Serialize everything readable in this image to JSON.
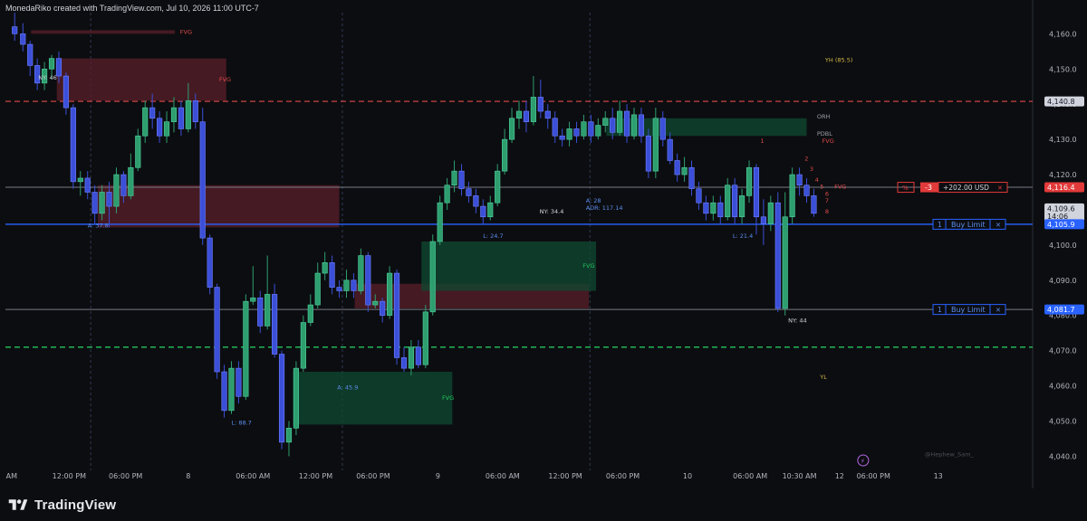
{
  "header": {
    "attribution": "MonedaRiko created with TradingView.com, Jul 10, 2026 11:00 UTC-7"
  },
  "footer": {
    "brand": "TradingView"
  },
  "colors": {
    "background": "#0c0d10",
    "bull": "#2e9e6f",
    "bear": "#3b4fd8",
    "fvg_bear": "#5a1f2a",
    "fvg_bull": "#0f4a32",
    "red_level": "#e04a4a",
    "green_level": "#22c55e",
    "blue_level": "#2962ff",
    "current_price_bg": "#e23a3a"
  },
  "chart_data": {
    "type": "candlestick",
    "title": "",
    "price_axis": {
      "ylim": [
        4036,
        4166
      ],
      "ticks": [
        "4,160.0",
        "4,150.0",
        "4,140.0",
        "4,130.0",
        "4,120.0",
        "4,110.0",
        "4,100.0",
        "4,090.0",
        "4,080.0",
        "4,070.0",
        "4,060.0",
        "4,050.0",
        "4,040.0"
      ],
      "tick_values": [
        4160,
        4150,
        4140,
        4130,
        4120,
        4110,
        4100,
        4090,
        4080,
        4070,
        4060,
        4050,
        4040
      ],
      "position": "right"
    },
    "time_axis": {
      "xlim": [
        0,
        100
      ],
      "labels": [
        {
          "t": 0.6,
          "text": "AM"
        },
        {
          "t": 6.2,
          "text": "12:00 PM"
        },
        {
          "t": 11.7,
          "text": "06:00 PM"
        },
        {
          "t": 17.8,
          "text": "8"
        },
        {
          "t": 24.1,
          "text": "06:00 AM"
        },
        {
          "t": 30.2,
          "text": "12:00 PM"
        },
        {
          "t": 35.8,
          "text": "06:00 PM"
        },
        {
          "t": 42.1,
          "text": "9"
        },
        {
          "t": 48.4,
          "text": "06:00 AM"
        },
        {
          "t": 54.5,
          "text": "12:00 PM"
        },
        {
          "t": 60.1,
          "text": "06:00 PM"
        },
        {
          "t": 66.4,
          "text": "10"
        },
        {
          "t": 72.5,
          "text": "06:00 AM"
        },
        {
          "t": 77.3,
          "text": "10:30 AM"
        },
        {
          "t": 81.2,
          "text": "12"
        },
        {
          "t": 84.5,
          "text": "06:00 PM"
        },
        {
          "t": 90.8,
          "text": "13"
        }
      ],
      "session_dividers": [
        8.3,
        32.8,
        56.9
      ]
    },
    "candles": [
      [
        0.9,
        4162,
        4160,
        4166,
        4158
      ],
      [
        1.7,
        4160,
        4157,
        4163,
        4155
      ],
      [
        2.4,
        4157,
        4151,
        4158,
        4148
      ],
      [
        3.1,
        4151,
        4146,
        4153,
        4144
      ],
      [
        3.8,
        4146,
        4150,
        4152,
        4144
      ],
      [
        4.5,
        4150,
        4153,
        4154,
        4147
      ],
      [
        5.2,
        4153,
        4148,
        4155,
        4146
      ],
      [
        5.9,
        4148,
        4139,
        4149,
        4137
      ],
      [
        6.6,
        4139,
        4118,
        4140,
        4116
      ],
      [
        7.3,
        4118,
        4119,
        4121,
        4114
      ],
      [
        8.0,
        4119,
        4115,
        4121,
        4113
      ],
      [
        8.7,
        4115,
        4109,
        4117,
        4106
      ],
      [
        9.4,
        4109,
        4115,
        4117,
        4107
      ],
      [
        10.1,
        4115,
        4111,
        4118,
        4105
      ],
      [
        10.8,
        4111,
        4120,
        4122,
        4109
      ],
      [
        11.5,
        4120,
        4114,
        4121,
        4112
      ],
      [
        12.2,
        4114,
        4122,
        4126,
        4113
      ],
      [
        12.9,
        4122,
        4131,
        4133,
        4121
      ],
      [
        13.6,
        4131,
        4139,
        4141,
        4129
      ],
      [
        14.3,
        4139,
        4136,
        4143,
        4133
      ],
      [
        15.0,
        4136,
        4131,
        4138,
        4129
      ],
      [
        15.7,
        4131,
        4135,
        4138,
        4129
      ],
      [
        16.4,
        4135,
        4139,
        4142,
        4132
      ],
      [
        17.1,
        4139,
        4133,
        4141,
        4131
      ],
      [
        17.8,
        4133,
        4141,
        4146,
        4132
      ],
      [
        18.5,
        4141,
        4135,
        4143,
        4133
      ],
      [
        19.2,
        4135,
        4102,
        4139,
        4100
      ],
      [
        19.9,
        4102,
        4088,
        4103,
        4086
      ],
      [
        20.6,
        4088,
        4064,
        4089,
        4062
      ],
      [
        21.3,
        4064,
        4053,
        4066,
        4051
      ],
      [
        22.0,
        4053,
        4065,
        4067,
        4052
      ],
      [
        22.7,
        4065,
        4057,
        4067,
        4055
      ],
      [
        23.4,
        4057,
        4084,
        4086,
        4056
      ],
      [
        24.1,
        4084,
        4085,
        4094,
        4083
      ],
      [
        24.8,
        4085,
        4077,
        4087,
        4075
      ],
      [
        25.5,
        4077,
        4086,
        4097,
        4076
      ],
      [
        26.2,
        4086,
        4069,
        4089,
        4068
      ],
      [
        26.9,
        4069,
        4044,
        4070,
        4042
      ],
      [
        27.6,
        4044,
        4048,
        4050,
        4040
      ],
      [
        28.3,
        4048,
        4065,
        4067,
        4046
      ],
      [
        29.0,
        4065,
        4078,
        4080,
        4064
      ],
      [
        29.7,
        4078,
        4083,
        4086,
        4077
      ],
      [
        30.4,
        4083,
        4092,
        4095,
        4082
      ],
      [
        31.1,
        4092,
        4095,
        4098,
        4090
      ],
      [
        31.8,
        4095,
        4088,
        4097,
        4086
      ],
      [
        32.5,
        4088,
        4087,
        4090,
        4085
      ],
      [
        33.2,
        4087,
        4090,
        4093,
        4085
      ],
      [
        33.9,
        4090,
        4087,
        4092,
        4085
      ],
      [
        34.6,
        4087,
        4097,
        4099,
        4086
      ],
      [
        35.3,
        4097,
        4083,
        4098,
        4081
      ],
      [
        36.0,
        4083,
        4084,
        4086,
        4082
      ],
      [
        36.7,
        4084,
        4080,
        4085,
        4078
      ],
      [
        37.4,
        4080,
        4092,
        4094,
        4079
      ],
      [
        38.1,
        4092,
        4068,
        4093,
        4066
      ],
      [
        38.8,
        4068,
        4065,
        4071,
        4064
      ],
      [
        39.5,
        4065,
        4071,
        4073,
        4063
      ],
      [
        40.2,
        4071,
        4066,
        4073,
        4065
      ],
      [
        40.9,
        4066,
        4081,
        4083,
        4065
      ],
      [
        41.6,
        4081,
        4101,
        4103,
        4080
      ],
      [
        42.3,
        4101,
        4112,
        4114,
        4100
      ],
      [
        43.0,
        4112,
        4117,
        4119,
        4110
      ],
      [
        43.7,
        4117,
        4121,
        4124,
        4115
      ],
      [
        44.4,
        4121,
        4116,
        4123,
        4114
      ],
      [
        45.1,
        4116,
        4114,
        4118,
        4112
      ],
      [
        45.8,
        4114,
        4111,
        4116,
        4109
      ],
      [
        46.5,
        4111,
        4108,
        4113,
        4106
      ],
      [
        47.2,
        4108,
        4112,
        4114,
        4107
      ],
      [
        47.9,
        4112,
        4121,
        4123,
        4111
      ],
      [
        48.6,
        4121,
        4130,
        4133,
        4120
      ],
      [
        49.3,
        4130,
        4136,
        4139,
        4129
      ],
      [
        50.0,
        4136,
        4138,
        4141,
        4133
      ],
      [
        50.7,
        4138,
        4135,
        4141,
        4132
      ],
      [
        51.4,
        4135,
        4142,
        4148,
        4134
      ],
      [
        52.1,
        4142,
        4138,
        4147,
        4136
      ],
      [
        52.8,
        4138,
        4136,
        4140,
        4133
      ],
      [
        53.5,
        4136,
        4131,
        4138,
        4129
      ],
      [
        54.2,
        4131,
        4130,
        4133,
        4128
      ],
      [
        54.9,
        4130,
        4133,
        4135,
        4128
      ],
      [
        55.6,
        4133,
        4131,
        4135,
        4129
      ],
      [
        56.3,
        4131,
        4135,
        4137,
        4130
      ],
      [
        57.0,
        4135,
        4131,
        4137,
        4129
      ],
      [
        57.7,
        4131,
        4134,
        4136,
        4130
      ],
      [
        58.4,
        4134,
        4136,
        4138,
        4132
      ],
      [
        59.1,
        4136,
        4132,
        4139,
        4130
      ],
      [
        59.8,
        4132,
        4138,
        4141,
        4131
      ],
      [
        60.5,
        4138,
        4131,
        4140,
        4129
      ],
      [
        61.2,
        4131,
        4137,
        4139,
        4130
      ],
      [
        61.9,
        4137,
        4131,
        4139,
        4129
      ],
      [
        62.6,
        4131,
        4121,
        4133,
        4119
      ],
      [
        63.3,
        4121,
        4136,
        4139,
        4119
      ],
      [
        64.0,
        4136,
        4130,
        4138,
        4128
      ],
      [
        64.7,
        4130,
        4124,
        4132,
        4123
      ],
      [
        65.4,
        4124,
        4120,
        4126,
        4118
      ],
      [
        66.1,
        4120,
        4122,
        4125,
        4118
      ],
      [
        66.8,
        4122,
        4116,
        4124,
        4114
      ],
      [
        67.5,
        4116,
        4112,
        4118,
        4110
      ],
      [
        68.2,
        4112,
        4109,
        4114,
        4107
      ],
      [
        68.9,
        4109,
        4112,
        4114,
        4107
      ],
      [
        69.6,
        4112,
        4108,
        4114,
        4106
      ],
      [
        70.3,
        4108,
        4117,
        4119,
        4107
      ],
      [
        71.0,
        4117,
        4108,
        4119,
        4106
      ],
      [
        71.7,
        4108,
        4114,
        4116,
        4106
      ],
      [
        72.4,
        4114,
        4122,
        4124,
        4112
      ],
      [
        73.1,
        4122,
        4108,
        4123,
        4103
      ],
      [
        73.8,
        4108,
        4106,
        4113,
        4100
      ],
      [
        74.5,
        4106,
        4112,
        4114,
        4104
      ],
      [
        75.2,
        4112,
        4082,
        4115,
        4081
      ],
      [
        75.9,
        4082,
        4108,
        4115,
        4080
      ],
      [
        76.6,
        4108,
        4120,
        4122,
        4106
      ],
      [
        77.3,
        4120,
        4117,
        4122,
        4114
      ],
      [
        78.0,
        4117,
        4114,
        4119,
        4112
      ],
      [
        78.7,
        4114,
        4109,
        4116,
        4108
      ]
    ],
    "levels": [
      {
        "price": 4140.8,
        "style": "dashed",
        "color": "red",
        "label": "4,140.8"
      },
      {
        "price": 4116.4,
        "style": "solid",
        "color": "gray",
        "label": "4,116.4"
      },
      {
        "price": 4105.9,
        "style": "solid",
        "color": "blue",
        "label": "4,105.9"
      },
      {
        "price": 4081.7,
        "style": "solid",
        "color": "gray",
        "label": "4,081.7"
      },
      {
        "price": 4071.0,
        "style": "dashed",
        "color": "green",
        "label": ""
      }
    ],
    "fvg_zones": [
      {
        "x0": 2.5,
        "x1": 16.5,
        "p0": 4161,
        "p1": 4160,
        "kind": "bear",
        "label": "FVG",
        "label_at": 17.0
      },
      {
        "x0": 5.0,
        "x1": 21.5,
        "p0": 4153,
        "p1": 4141,
        "kind": "bear",
        "label": "FVG",
        "label_at": 20.8
      },
      {
        "x0": 9.0,
        "x1": 32.5,
        "p0": 4117,
        "p1": 4105,
        "kind": "bear",
        "label": "",
        "label_at": 0
      },
      {
        "x0": 34.0,
        "x1": 56.8,
        "p0": 4089,
        "p1": 4082,
        "kind": "bear",
        "label": "",
        "label_at": 0
      },
      {
        "x0": 40.5,
        "x1": 57.5,
        "p0": 4101,
        "p1": 4087,
        "kind": "bull",
        "label": "FVG",
        "label_at": 56.2
      },
      {
        "x0": 28.0,
        "x1": 43.5,
        "p0": 4064,
        "p1": 4049,
        "kind": "bull",
        "label": "FVG",
        "label_at": 42.5
      },
      {
        "x0": 58.5,
        "x1": 78.0,
        "p0": 4136,
        "p1": 4131,
        "kind": "bull",
        "label": "",
        "label_at": 0
      }
    ],
    "annotations": [
      {
        "t": 3.2,
        "p": 4147,
        "text": "NY: 46",
        "color": "#d1d4dc"
      },
      {
        "t": 8.0,
        "p": 4105,
        "text": "A: 37.8",
        "color": "#5b8def"
      },
      {
        "t": 22.0,
        "p": 4049,
        "text": "L: 88.7",
        "color": "#5b8def"
      },
      {
        "t": 32.3,
        "p": 4059,
        "text": "A: 45.9",
        "color": "#5b8def"
      },
      {
        "t": 46.5,
        "p": 4102,
        "text": "L: 24.7",
        "color": "#5b8def"
      },
      {
        "t": 52.0,
        "p": 4109,
        "text": "NY: 34.4",
        "color": "#d1d4dc"
      },
      {
        "t": 56.5,
        "p": 4112,
        "text": "A: 28",
        "color": "#5b8def"
      },
      {
        "t": 56.5,
        "p": 4110,
        "text": "ADR: 117.14",
        "color": "#5b8def"
      },
      {
        "t": 70.8,
        "p": 4102,
        "text": "L: 21.4",
        "color": "#5b8def"
      },
      {
        "t": 76.2,
        "p": 4078,
        "text": "NY: 44",
        "color": "#d1d4dc"
      },
      {
        "t": 79.8,
        "p": 4152,
        "text": "YH (85.5)",
        "color": "#d4b84a"
      },
      {
        "t": 79.3,
        "p": 4062,
        "text": "YL",
        "color": "#d4b84a"
      },
      {
        "t": 79.0,
        "p": 4136,
        "text": "ORH",
        "color": "#9aa0a6"
      },
      {
        "t": 79.0,
        "p": 4131,
        "text": "PDBL",
        "color": "#9aa0a6"
      },
      {
        "t": 79.5,
        "p": 4129,
        "text": "FVG",
        "color": "#e04a4a"
      },
      {
        "t": 80.7,
        "p": 4116,
        "text": "FVG",
        "color": "#e04a4a"
      },
      {
        "t": 73.5,
        "p": 4129,
        "text": "1",
        "color": "#e04a4a"
      },
      {
        "t": 77.8,
        "p": 4124,
        "text": "2",
        "color": "#e04a4a"
      },
      {
        "t": 78.3,
        "p": 4121,
        "text": "3",
        "color": "#e04a4a"
      },
      {
        "t": 78.8,
        "p": 4118,
        "text": "4",
        "color": "#e04a4a"
      },
      {
        "t": 79.3,
        "p": 4116,
        "text": "5",
        "color": "#e04a4a"
      },
      {
        "t": 79.8,
        "p": 4114,
        "text": "6",
        "color": "#e04a4a"
      },
      {
        "t": 79.8,
        "p": 4112,
        "text": "7",
        "color": "#e04a4a"
      },
      {
        "t": 79.8,
        "p": 4109,
        "text": "8",
        "color": "#e04a4a"
      },
      {
        "t": 89.5,
        "p": 4040,
        "text": "@Hephew_Sam_",
        "color": "#4a4e58"
      }
    ],
    "position_widget": {
      "qty": "-3",
      "pnl": "+202.00 USD",
      "close": "✕",
      "percent_icon": "%"
    },
    "orders": [
      {
        "qty": "1",
        "label": "Buy Limit",
        "price": 4105.9,
        "close": "✕"
      },
      {
        "qty": "1",
        "label": "Buy Limit",
        "price": 4081.7,
        "close": "✕"
      }
    ],
    "price_labels": [
      {
        "text": "4,140.8",
        "price": 4140.8,
        "bg": "#d1d4dc",
        "fg": "#131722"
      },
      {
        "text": "4,116.4",
        "price": 4116.4,
        "bg": "#e23a3a",
        "fg": "#ffffff"
      },
      {
        "text": "4,109.6",
        "price": 4110.4,
        "bg": "#d1d4dc",
        "fg": "#131722"
      },
      {
        "text": "14:06",
        "price": 4108.2,
        "bg": "#d1d4dc",
        "fg": "#131722"
      },
      {
        "text": "4,105.9",
        "price": 4105.9,
        "bg": "#2962ff",
        "fg": "#ffffff"
      },
      {
        "text": "4,081.7",
        "price": 4081.7,
        "bg": "#2962ff",
        "fg": "#ffffff"
      }
    ]
  }
}
